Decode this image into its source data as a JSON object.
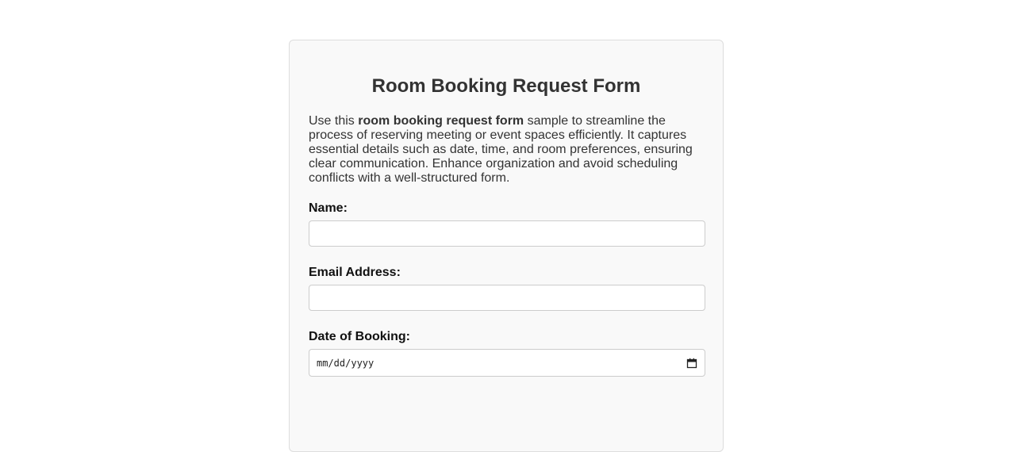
{
  "form": {
    "title": "Room Booking Request Form",
    "intro": {
      "prefix": "Use this ",
      "bold": "room booking request form",
      "suffix": " sample to streamline the process of reserving meeting or event spaces efficiently. It captures essential details such as date, time, and room preferences, ensuring clear communication. Enhance organization and avoid scheduling conflicts with a well-structured form."
    },
    "fields": {
      "name": {
        "label": "Name:",
        "value": ""
      },
      "email": {
        "label": "Email Address:",
        "value": ""
      },
      "date": {
        "label": "Date of Booking:",
        "placeholder": "mm/dd/yyyy",
        "icon": "calendar-icon"
      }
    }
  }
}
